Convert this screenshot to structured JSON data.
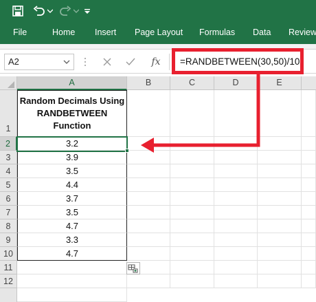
{
  "colors": {
    "excel_green": "#217346",
    "callout_red": "#e8202f"
  },
  "quick_access": {
    "save_icon": "save-icon",
    "undo_icon": "undo-icon",
    "undo_dropdown_icon": "chevron-down-icon",
    "redo_icon": "redo-icon",
    "redo_dropdown_icon": "chevron-down-icon",
    "customize_icon": "customize-quick-access-icon"
  },
  "ribbon": {
    "tabs": [
      "File",
      "Home",
      "Insert",
      "Page Layout",
      "Formulas",
      "Data",
      "Review"
    ]
  },
  "formula_bar": {
    "name_box": "A2",
    "cancel_icon": "close-icon",
    "enter_icon": "check-icon",
    "function_icon_label": "fx",
    "formula": "=RANDBETWEEN(30,50)/10"
  },
  "grid": {
    "columns": [
      "A",
      "B",
      "C",
      "D",
      "E"
    ],
    "rows": [
      "1",
      "2",
      "3",
      "4",
      "5",
      "6",
      "7",
      "8",
      "9",
      "10",
      "11",
      "12"
    ],
    "header_cell": "Random Decimals Using RANDBETWEEN Function",
    "values": [
      "3.2",
      "3.9",
      "3.5",
      "4.4",
      "3.7",
      "3.5",
      "4.7",
      "3.3",
      "4.7"
    ],
    "active_cell": "A2",
    "quick_analysis_icon": "quick-analysis-icon"
  }
}
